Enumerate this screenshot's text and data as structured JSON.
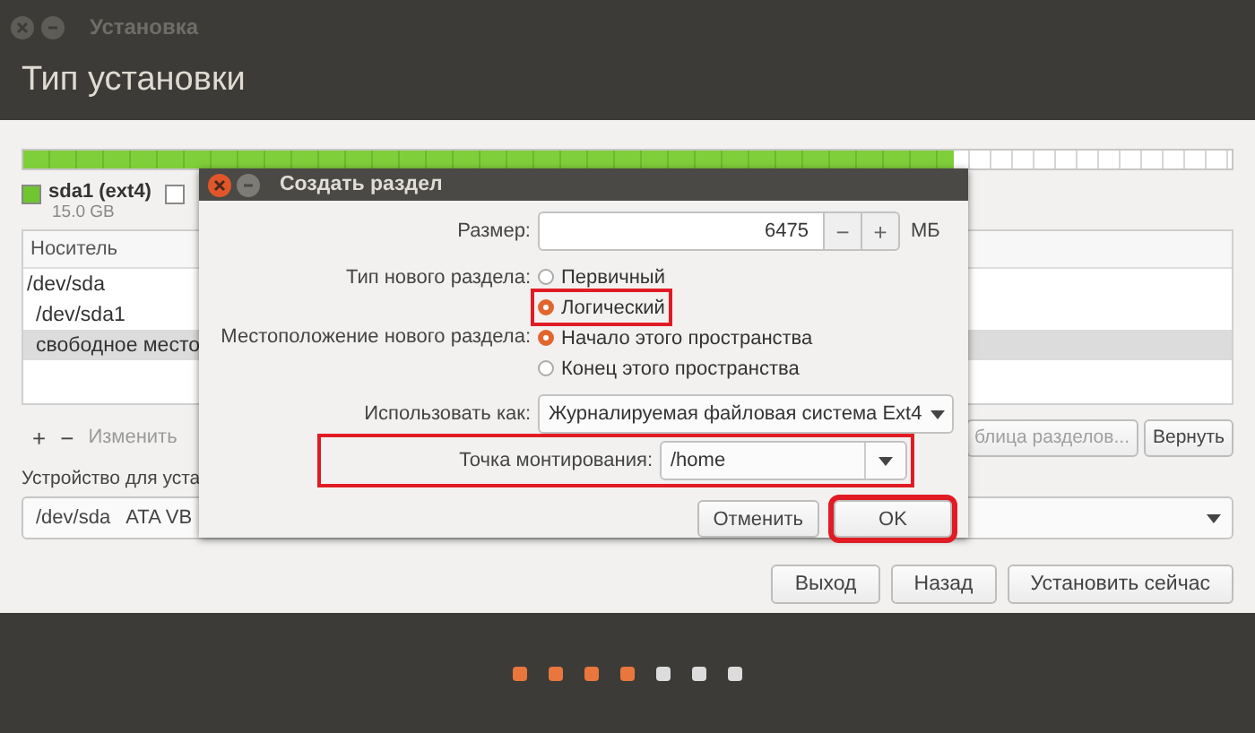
{
  "window": {
    "title": "Установка"
  },
  "page_title": "Тип установки",
  "partition_bar": {
    "level": 0.77
  },
  "legend": [
    {
      "label": "sda1 (ext4)",
      "size": "15.0 GB",
      "color": "#6fc62f"
    },
    {
      "color": "#ffffff"
    }
  ],
  "table": {
    "columns": [
      "Носитель"
    ],
    "rows": [
      {
        "label": "/dev/sda",
        "selected": false,
        "children": [
          {
            "label": "/dev/sda1",
            "selected": false
          },
          {
            "label": "свободное место",
            "selected": true
          }
        ]
      }
    ]
  },
  "toolbar": {
    "add": "+",
    "remove": "−",
    "change": {
      "label": "Изменить",
      "disabled": true
    },
    "new_table": {
      "label": "блица разделов...",
      "disabled": true
    },
    "revert": {
      "label": "Вернуть",
      "disabled": false
    }
  },
  "device_label": "Устройство для уста",
  "device_select": {
    "value": "/dev/sda   ATA VB"
  },
  "buttons": [
    "Выход",
    "Назад",
    "Установить сейчас"
  ],
  "progress_dots": [
    {
      "done": true
    },
    {
      "done": true
    },
    {
      "done": true
    },
    {
      "done": true
    },
    {
      "done": false
    },
    {
      "done": false
    },
    {
      "done": false
    }
  ],
  "dialog": {
    "title": "Создать раздел",
    "size": {
      "label": "Размер:",
      "value": "6475",
      "minus": "−",
      "plus": "+",
      "unit": "МБ"
    },
    "type": {
      "label": "Тип нового раздела:",
      "options": [
        {
          "label": "Первичный",
          "selected": false,
          "highlighted": false
        },
        {
          "label": "Логический",
          "selected": true,
          "highlighted": true
        }
      ]
    },
    "location": {
      "label": "Местоположение нового раздела:",
      "options": [
        {
          "label": "Начало этого пространства",
          "selected": true,
          "highlighted": false
        },
        {
          "label": "Конец этого пространства",
          "selected": false,
          "highlighted": false
        }
      ]
    },
    "use_as": {
      "label": "Использовать как:",
      "value": "Журналируемая файловая система Ext4"
    },
    "mount": {
      "label": "Точка монтирования:",
      "value": "/home",
      "highlighted": true
    },
    "cancel": {
      "label": "Отменить",
      "highlighted": false
    },
    "ok": {
      "label": "OK",
      "highlighted": true
    }
  }
}
